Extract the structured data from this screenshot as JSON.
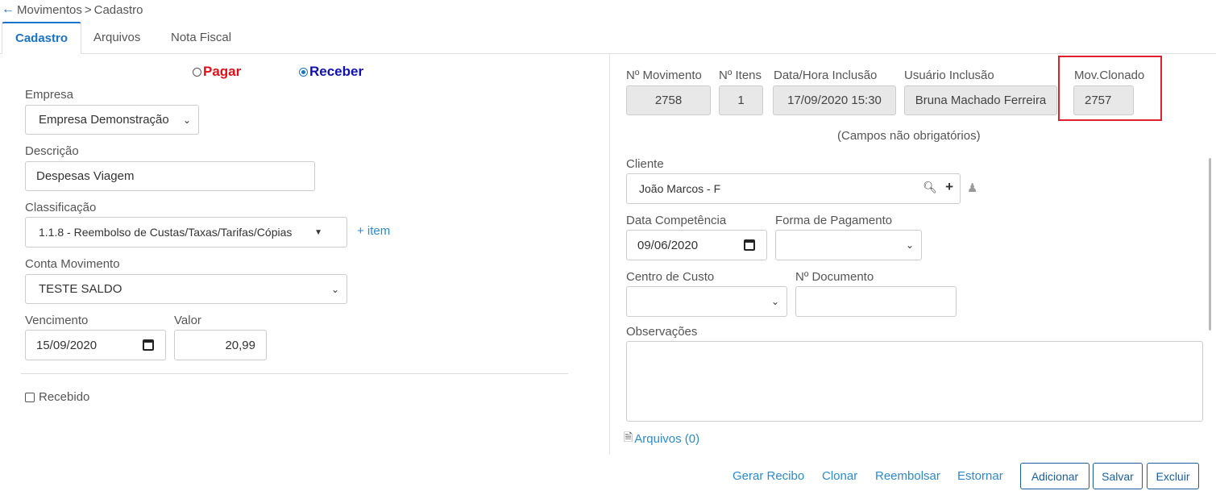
{
  "breadcrumb": {
    "section": "Movimentos",
    "separator": ">",
    "page": "Cadastro"
  },
  "tabs": [
    {
      "label": "Cadastro",
      "active": true
    },
    {
      "label": "Arquivos",
      "active": false
    },
    {
      "label": "Nota Fiscal",
      "active": false
    }
  ],
  "type_radio": {
    "pagar_label": "Pagar",
    "pagar_color": "#e0101a",
    "receber_label": "Receber",
    "receber_color": "#1010b0",
    "selected": "Receber"
  },
  "left": {
    "empresa_label": "Empresa",
    "empresa_value": "Empresa Demonstração",
    "descricao_label": "Descrição",
    "descricao_value": "Despesas Viagem",
    "classificacao_label": "Classificação",
    "classificacao_value": "1.1.8 - Reembolso de Custas/Taxas/Tarifas/Cópias",
    "add_item_label": "+ item",
    "conta_label": "Conta Movimento",
    "conta_value": "TESTE SALDO",
    "vencimento_label": "Vencimento",
    "vencimento_value": "15/09/2020",
    "valor_label": "Valor",
    "valor_value": "20,99",
    "recebido_label": "Recebido",
    "recebido_checked": false
  },
  "right": {
    "n_movimento_label": "Nº Movimento",
    "n_movimento_value": "2758",
    "n_itens_label": "Nº Itens",
    "n_itens_value": "1",
    "data_inclusao_label": "Data/Hora Inclusão",
    "data_inclusao_value": "17/09/2020 15:30",
    "usuario_label": "Usuário Inclusão",
    "usuario_value": "Bruna Machado Ferreira",
    "mov_clonado_label": "Mov.Clonado",
    "mov_clonado_value": "2757",
    "optional_note": "(Campos não obrigatórios)",
    "cliente_label": "Cliente",
    "cliente_value": "João Marcos - F",
    "data_competencia_label": "Data Competência",
    "data_competencia_value": "09/06/2020",
    "forma_pagamento_label": "Forma de Pagamento",
    "forma_pagamento_value": "",
    "centro_custo_label": "Centro de Custo",
    "centro_custo_value": "",
    "n_documento_label": "Nº Documento",
    "n_documento_value": "",
    "observacoes_label": "Observações",
    "observacoes_value": "",
    "arquivos_link": "Arquivos (0)"
  },
  "actions": {
    "gerar_recibo": "Gerar Recibo",
    "clonar": "Clonar",
    "reembolsar": "Reembolsar",
    "estornar": "Estornar",
    "adicionar": "Adicionar",
    "salvar": "Salvar",
    "excluir": "Excluir"
  },
  "colors": {
    "accent": "#1a73c9",
    "highlight_border": "#e0202a"
  }
}
